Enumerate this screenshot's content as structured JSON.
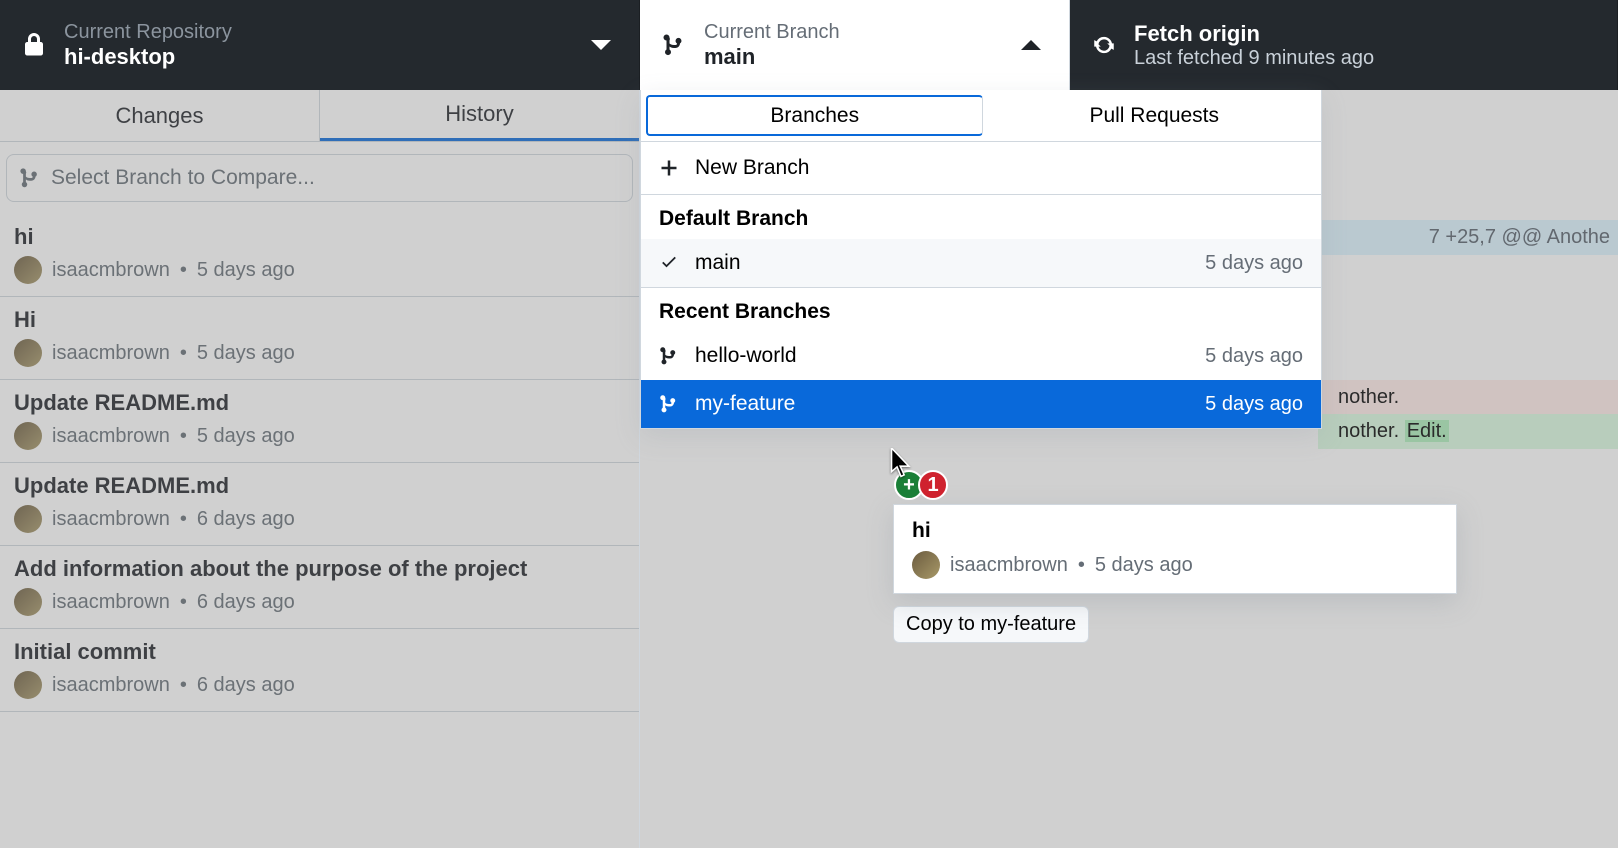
{
  "topbar": {
    "repo_label": "Current Repository",
    "repo_name": "hi-desktop",
    "branch_label": "Current Branch",
    "branch_name": "main",
    "fetch_title": "Fetch origin",
    "fetch_sub": "Last fetched 9 minutes ago"
  },
  "tabs": {
    "changes": "Changes",
    "history": "History"
  },
  "compare_placeholder": "Select Branch to Compare...",
  "commits": [
    {
      "title": "hi",
      "author": "isaacmbrown",
      "time": "5 days ago"
    },
    {
      "title": "Hi",
      "author": "isaacmbrown",
      "time": "5 days ago"
    },
    {
      "title": "Update README.md",
      "author": "isaacmbrown",
      "time": "5 days ago"
    },
    {
      "title": "Update README.md",
      "author": "isaacmbrown",
      "time": "6 days ago"
    },
    {
      "title": "Add information about the purpose of the project",
      "author": "isaacmbrown",
      "time": "6 days ago"
    },
    {
      "title": "Initial commit",
      "author": "isaacmbrown",
      "time": "6 days ago"
    }
  ],
  "dropdown": {
    "tab_branches": "Branches",
    "tab_prs": "Pull Requests",
    "new_branch": "New Branch",
    "default_head": "Default Branch",
    "recent_head": "Recent Branches",
    "default_branch": {
      "name": "main",
      "time": "5 days ago"
    },
    "recent": [
      {
        "name": "hello-world",
        "time": "5 days ago"
      },
      {
        "name": "my-feature",
        "time": "5 days ago"
      }
    ]
  },
  "drag": {
    "title": "hi",
    "author": "isaacmbrown",
    "time": "5 days ago",
    "tooltip": "Copy to my-feature",
    "badge_count": "1"
  },
  "diff": {
    "hunk": "7 +25,7 @@ Anothe",
    "del": "nother.",
    "add_prefix": "nother. ",
    "add_chip": "Edit."
  }
}
